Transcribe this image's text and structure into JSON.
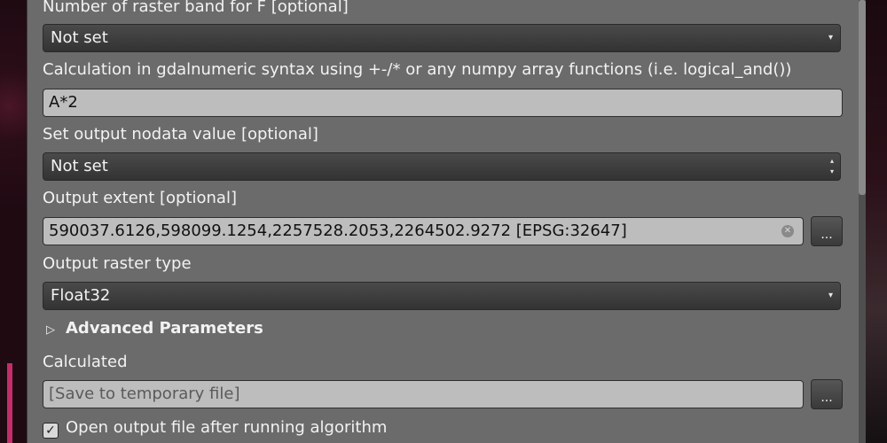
{
  "fields": {
    "raster_band_f": {
      "label": "Number of raster band for F [optional]",
      "value": "Not set"
    },
    "calculation": {
      "label": "Calculation in gdalnumeric syntax using +-/* or any numpy array functions (i.e. logical_and())",
      "value": "A*2"
    },
    "nodata": {
      "label": "Set output nodata value [optional]",
      "value": "Not set"
    },
    "extent": {
      "label": "Output extent [optional]",
      "value": "590037.6126,598099.1254,2257528.2053,2264502.9272 [EPSG:32647]",
      "browse": "..."
    },
    "raster_type": {
      "label": "Output raster type",
      "value": "Float32"
    },
    "advanced": {
      "label": "Advanced Parameters"
    },
    "calculated": {
      "label": "Calculated",
      "placeholder": "[Save to temporary file]",
      "browse": "..."
    },
    "open_output": {
      "label": "Open output file after running algorithm",
      "checked": true
    }
  },
  "icons": {
    "combo_arrow": "▾",
    "spin_up": "▴",
    "spin_down": "▾",
    "clear": "✕",
    "expand": "▷",
    "check": "✓"
  }
}
